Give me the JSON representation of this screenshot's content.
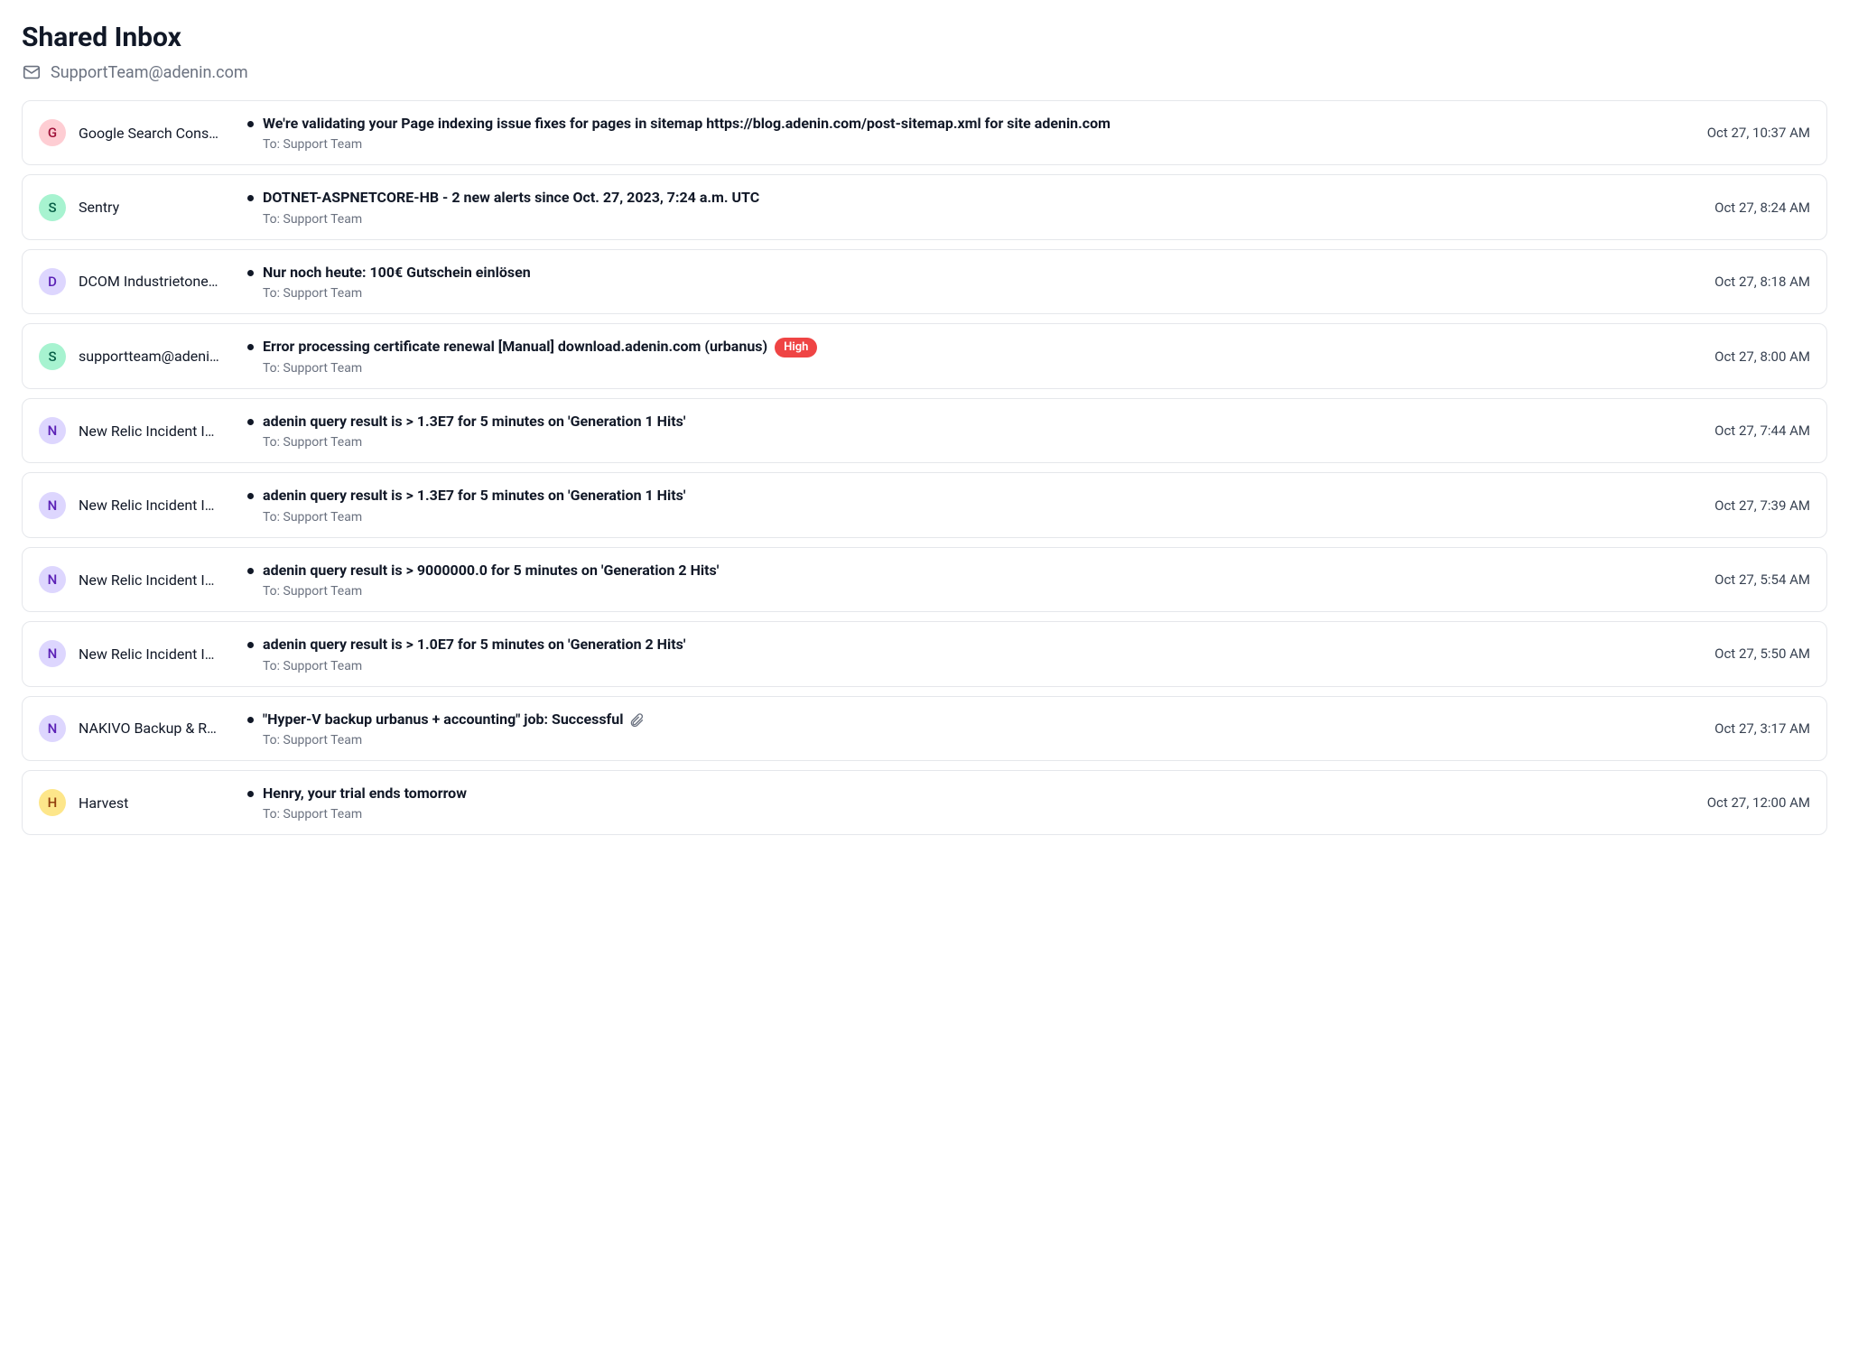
{
  "header": {
    "title": "Shared Inbox",
    "address": "SupportTeam@adenin.com"
  },
  "to_prefix": "To: ",
  "messages": [
    {
      "avatar_letter": "G",
      "avatar_class": "av-pink",
      "sender": "Google Search Cons…",
      "subject": "We're validating your Page indexing issue fixes for pages in sitemap https://blog.adenin.com/post-sitemap.xml for site adenin.com",
      "to": "Support Team",
      "time": "Oct 27, 10:37 AM",
      "unread": true,
      "badge": null,
      "attachment": false
    },
    {
      "avatar_letter": "S",
      "avatar_class": "av-green",
      "sender": "Sentry",
      "subject": "DOTNET-ASPNETCORE-HB - 2 new alerts since Oct. 27, 2023, 7:24 a.m. UTC",
      "to": "Support Team",
      "time": "Oct 27, 8:24 AM",
      "unread": true,
      "badge": null,
      "attachment": false
    },
    {
      "avatar_letter": "D",
      "avatar_class": "av-purple",
      "sender": "DCOM Industrietone…",
      "subject": "Nur noch heute: 100€ Gutschein einlösen",
      "to": "Support Team",
      "time": "Oct 27, 8:18 AM",
      "unread": true,
      "badge": null,
      "attachment": false
    },
    {
      "avatar_letter": "S",
      "avatar_class": "av-green",
      "sender": "supportteam@adeni…",
      "subject": "Error processing certificate renewal [Manual] download.adenin.com (urbanus)",
      "to": "Support Team",
      "time": "Oct 27, 8:00 AM",
      "unread": true,
      "badge": "High",
      "attachment": false
    },
    {
      "avatar_letter": "N",
      "avatar_class": "av-purple",
      "sender": "New Relic Incident I…",
      "subject": "adenin query result is > 1.3E7 for 5 minutes on 'Generation 1 Hits'",
      "to": "Support Team",
      "time": "Oct 27, 7:44 AM",
      "unread": true,
      "badge": null,
      "attachment": false
    },
    {
      "avatar_letter": "N",
      "avatar_class": "av-purple",
      "sender": "New Relic Incident I…",
      "subject": "adenin query result is > 1.3E7 for 5 minutes on 'Generation 1 Hits'",
      "to": "Support Team",
      "time": "Oct 27, 7:39 AM",
      "unread": true,
      "badge": null,
      "attachment": false
    },
    {
      "avatar_letter": "N",
      "avatar_class": "av-purple",
      "sender": "New Relic Incident I…",
      "subject": "adenin query result is > 9000000.0 for 5 minutes on 'Generation 2 Hits'",
      "to": "Support Team",
      "time": "Oct 27, 5:54 AM",
      "unread": true,
      "badge": null,
      "attachment": false
    },
    {
      "avatar_letter": "N",
      "avatar_class": "av-purple",
      "sender": "New Relic Incident I…",
      "subject": "adenin query result is > 1.0E7 for 5 minutes on 'Generation 2 Hits'",
      "to": "Support Team",
      "time": "Oct 27, 5:50 AM",
      "unread": true,
      "badge": null,
      "attachment": false
    },
    {
      "avatar_letter": "N",
      "avatar_class": "av-purple",
      "sender": "NAKIVO Backup & R…",
      "subject": "\"Hyper-V backup urbanus + accounting\" job: Successful",
      "to": "Support Team",
      "time": "Oct 27, 3:17 AM",
      "unread": true,
      "badge": null,
      "attachment": true
    },
    {
      "avatar_letter": "H",
      "avatar_class": "av-amber",
      "sender": "Harvest",
      "subject": "Henry, your trial ends tomorrow",
      "to": "Support Team",
      "time": "Oct 27, 12:00 AM",
      "unread": true,
      "badge": null,
      "attachment": false
    }
  ]
}
